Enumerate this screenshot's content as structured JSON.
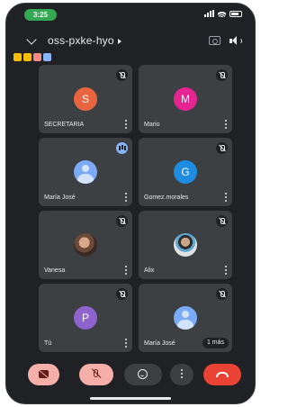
{
  "status_bar": {
    "time": "3:25"
  },
  "header": {
    "meeting_code": "oss-pxke-hyo"
  },
  "chips": [
    {
      "icon": "captions-chip-icon",
      "color": "#fbbc04"
    },
    {
      "icon": "list-chip-icon",
      "color": "#fbbc04"
    },
    {
      "icon": "record-chip-icon",
      "color": "#f28b82"
    },
    {
      "icon": "info-chip-icon",
      "color": "#8ab4f8"
    }
  ],
  "tiles": [
    {
      "name": "SECRETARIA",
      "avatar_letter": "S",
      "avatar_color": "#e8653f",
      "avatar_type": "letter",
      "badge": "muted"
    },
    {
      "name": "Mario",
      "avatar_letter": "M",
      "avatar_color": "#e52592",
      "avatar_type": "letter",
      "badge": "muted"
    },
    {
      "name": "María José",
      "avatar_letter": "",
      "avatar_color": "#7baaf7",
      "avatar_type": "generic",
      "badge": "speaking"
    },
    {
      "name": "Gomez.morales",
      "avatar_letter": "G",
      "avatar_color": "#1e8ce0",
      "avatar_type": "letter",
      "badge": "muted"
    },
    {
      "name": "Vanesa",
      "avatar_letter": "",
      "avatar_color": "",
      "avatar_type": "photo-1",
      "badge": "muted"
    },
    {
      "name": "Alix",
      "avatar_letter": "",
      "avatar_color": "",
      "avatar_type": "photo-2",
      "badge": "muted"
    },
    {
      "name": "Tú",
      "avatar_letter": "P",
      "avatar_color": "#8e63ce",
      "avatar_type": "letter",
      "badge": "muted"
    },
    {
      "name": "María José",
      "avatar_letter": "",
      "avatar_color": "#7baaf7",
      "avatar_type": "generic",
      "badge": "muted",
      "more_label": "1 más"
    }
  ],
  "controls": {
    "camera": "camera-off-icon",
    "mic": "mic-off-icon",
    "reactions": "emoji-icon",
    "more": "more-vert-icon",
    "leave": "hang-up-icon"
  }
}
